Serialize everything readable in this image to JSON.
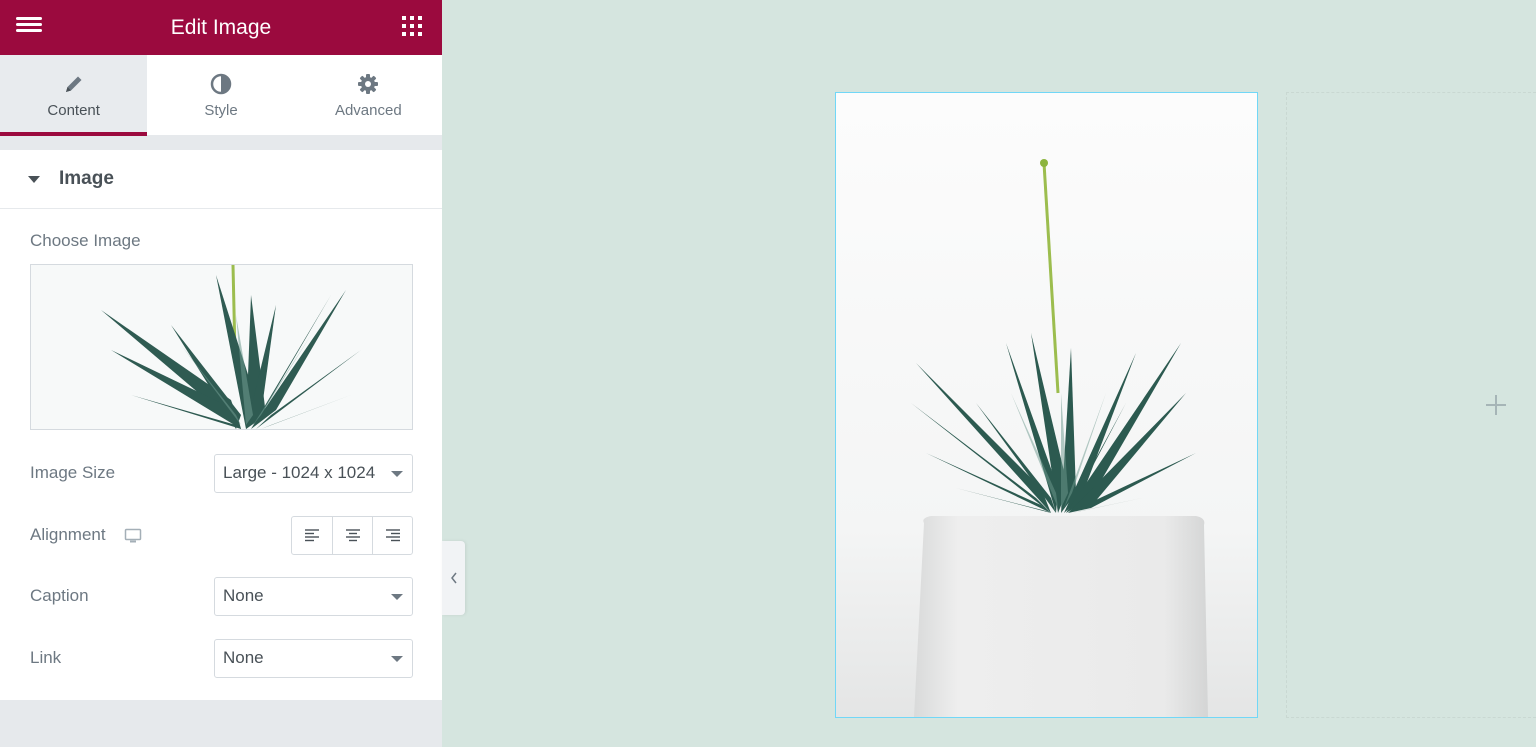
{
  "header": {
    "title": "Edit Image",
    "menu_icon": "hamburger-icon",
    "apps_icon": "grid-icon"
  },
  "tabs": [
    {
      "label": "Content",
      "icon": "pencil-icon",
      "active": true
    },
    {
      "label": "Style",
      "icon": "half-circle-icon",
      "active": false
    },
    {
      "label": "Advanced",
      "icon": "gear-icon",
      "active": false
    }
  ],
  "section": {
    "title": "Image",
    "choose_image_label": "Choose Image",
    "image_size": {
      "label": "Image Size",
      "value": "Large - 1024 x 1024"
    },
    "alignment": {
      "label": "Alignment",
      "device_icon": "desktop-icon",
      "options": [
        "left",
        "center",
        "right"
      ]
    },
    "caption": {
      "label": "Caption",
      "value": "None"
    },
    "link": {
      "label": "Link",
      "value": "None"
    }
  },
  "colors": {
    "brand": "#9b0a3e",
    "canvas": "#d5e5df",
    "selection_outline": "#71d7f7"
  },
  "canvas": {
    "add_icon": "plus-icon",
    "collapse_icon": "chevron-left-icon"
  }
}
